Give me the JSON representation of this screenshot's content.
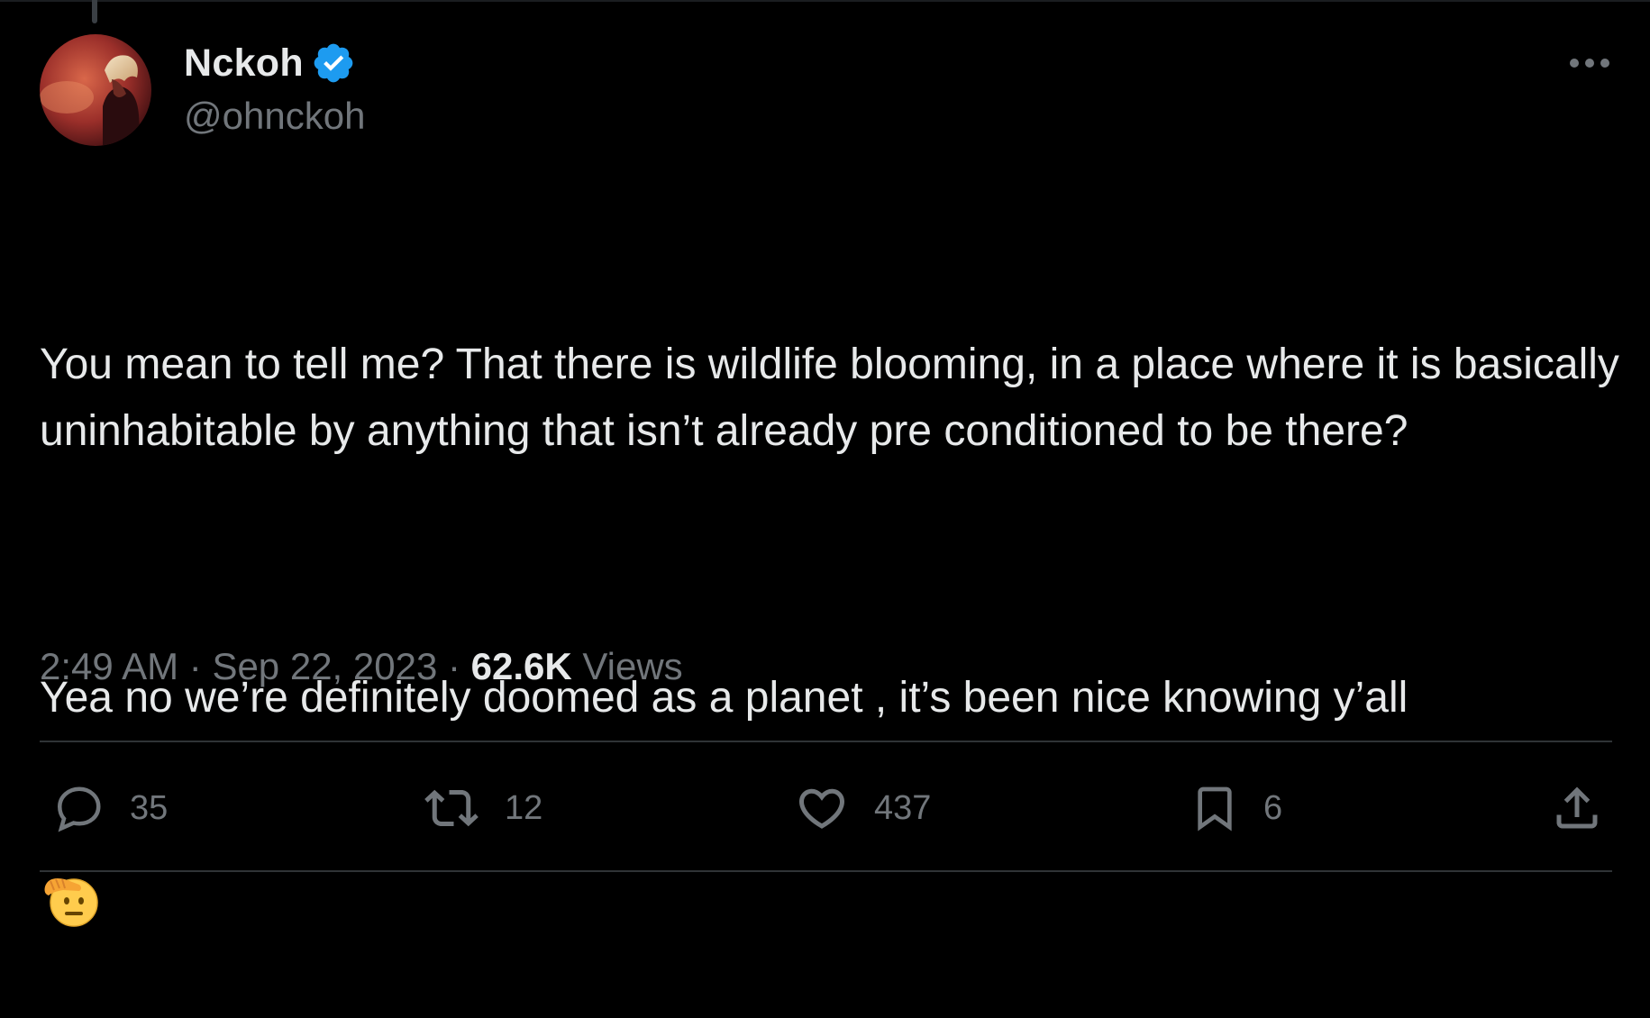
{
  "author": {
    "display_name": "Nckoh",
    "handle": "@ohnckoh",
    "verified": true,
    "avatar": "avatar-image"
  },
  "tweet": {
    "paragraph_1": "You mean to tell me? That there is wildlife blooming, in a place where it is basically uninhabitable by anything that isn’t already pre conditioned to be there?",
    "paragraph_2": "Yea no we’re definitely doomed as a planet , it’s been nice knowing y’all",
    "emoji": "saluting-face-emoji"
  },
  "meta": {
    "time": "2:49 AM",
    "separator": " · ",
    "date": "Sep 22, 2023",
    "views_count": "62.6K",
    "views_label": " Views"
  },
  "actions": {
    "replies": "35",
    "retweets": "12",
    "likes": "437",
    "bookmarks": "6"
  },
  "colors": {
    "background": "#000000",
    "text_primary": "#e7e9ea",
    "text_secondary": "#71767b",
    "divider": "#2f3336",
    "verified_blue": "#1d9bf0"
  }
}
